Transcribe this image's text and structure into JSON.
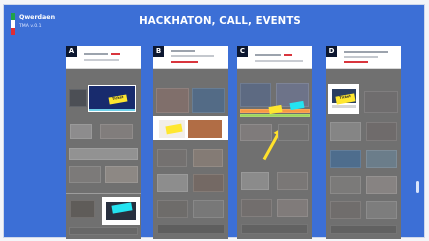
{
  "board": {
    "title": "HACKHATON, CALL, EVENTS",
    "brand_title": "Qwerdaen",
    "brand_subtitle": "TMA v.0.1",
    "accent_color": "#3c6fd6",
    "flag_colors": [
      "#20a34a",
      "#ffffff",
      "#de2d35"
    ]
  },
  "panels": [
    {
      "letter": "A",
      "note": "Ticket",
      "note_color": "yellow"
    },
    {
      "letter": "B",
      "note": "",
      "note_color": "yellow"
    },
    {
      "letter": "C",
      "note": "",
      "note_color": "cyan"
    },
    {
      "letter": "D",
      "note": "Ticket",
      "note_color": "yellow"
    }
  ]
}
